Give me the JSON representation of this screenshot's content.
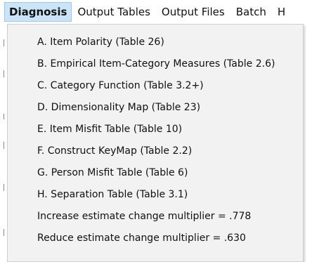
{
  "menubar": {
    "items": [
      {
        "label": "Diagnosis"
      },
      {
        "label": "Output Tables"
      },
      {
        "label": "Output Files"
      },
      {
        "label": "Batch"
      },
      {
        "label": "H"
      }
    ]
  },
  "diagnosis_menu": {
    "items": [
      {
        "label": "A. Item Polarity (Table 26)"
      },
      {
        "label": "B. Empirical Item-Category Measures (Table 2.6)"
      },
      {
        "label": "C. Category Function (Table 3.2+)"
      },
      {
        "label": "D. Dimensionality Map (Table 23)"
      },
      {
        "label": "E. Item Misfit Table (Table 10)"
      },
      {
        "label": "F. Construct KeyMap (Table 2.2)"
      },
      {
        "label": "G. Person Misfit Table (Table 6)"
      },
      {
        "label": "H. Separation Table (Table 3.1)"
      },
      {
        "label": "Increase estimate change multiplier = .778"
      },
      {
        "label": "Reduce estimate change multiplier = .630"
      }
    ]
  }
}
